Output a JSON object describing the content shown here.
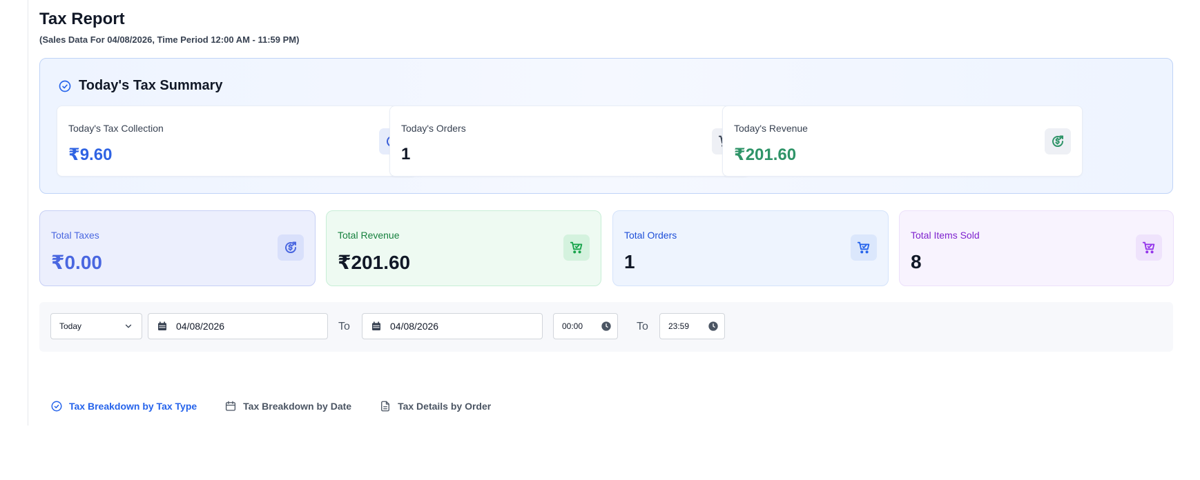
{
  "header": {
    "title": "Tax Report",
    "subtitle": "(Sales Data For 04/08/2026, Time Period 12:00 AM - 11:59 PM)"
  },
  "today_summary": {
    "title": "Today's Tax Summary",
    "cards": [
      {
        "label": "Today's Tax Collection",
        "value": "₹9.60",
        "icon": "dollar-refresh-icon",
        "color": "#2f63e3"
      },
      {
        "label": "Today's Orders",
        "value": "1",
        "icon": "cart-icon",
        "color": "#111827"
      },
      {
        "label": "Today's Revenue",
        "value": "₹201.60",
        "icon": "dollar-refresh-icon",
        "color": "#2f9468"
      }
    ]
  },
  "totals": [
    {
      "label": "Total Taxes",
      "value": "₹0.00",
      "icon": "dollar-refresh-icon",
      "accent": "#4a67e0"
    },
    {
      "label": "Total Revenue",
      "value": "₹201.60",
      "icon": "cart-icon",
      "accent": "#15803d"
    },
    {
      "label": "Total Orders",
      "value": "1",
      "icon": "cart-icon",
      "accent": "#1d4ed8"
    },
    {
      "label": "Total Items Sold",
      "value": "8",
      "icon": "cart-icon",
      "accent": "#7e22ce"
    }
  ],
  "filters": {
    "period": "Today",
    "from_date": "04/08/2026",
    "to_label": "To",
    "to_date": "04/08/2026",
    "from_time": "00:00",
    "to_time": "23:59"
  },
  "tabs": [
    {
      "label": "Tax Breakdown by Tax Type",
      "icon": "check-circle-icon",
      "active": true
    },
    {
      "label": "Tax Breakdown by Date",
      "icon": "calendar-icon",
      "active": false
    },
    {
      "label": "Tax Details by Order",
      "icon": "document-icon",
      "active": false
    }
  ]
}
